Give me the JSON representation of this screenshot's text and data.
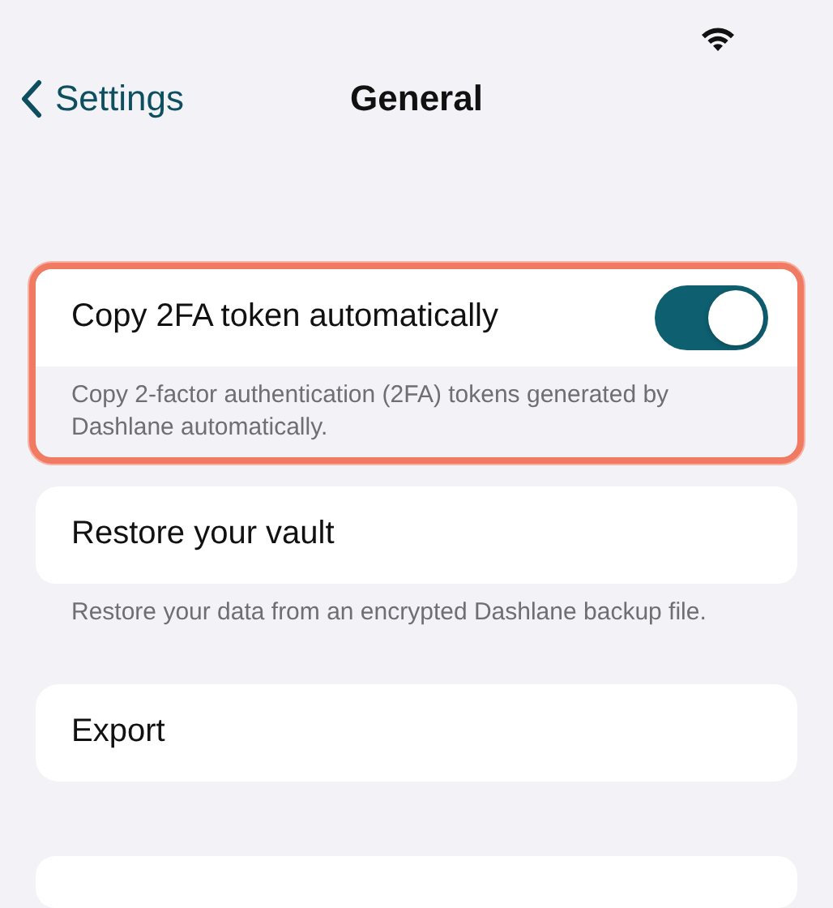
{
  "nav": {
    "back_label": "Settings",
    "title": "General"
  },
  "sections": [
    {
      "kind": "toggle",
      "label": "Copy 2FA token automatically",
      "on": true,
      "highlighted": true,
      "description": "Copy 2-factor authentication (2FA) tokens generated by Dashlane automatically."
    },
    {
      "kind": "link",
      "label": "Restore your vault",
      "highlighted": false,
      "description": "Restore your data from an encrypted Dashlane backup file."
    },
    {
      "kind": "link",
      "label": "Export",
      "highlighted": false
    }
  ]
}
